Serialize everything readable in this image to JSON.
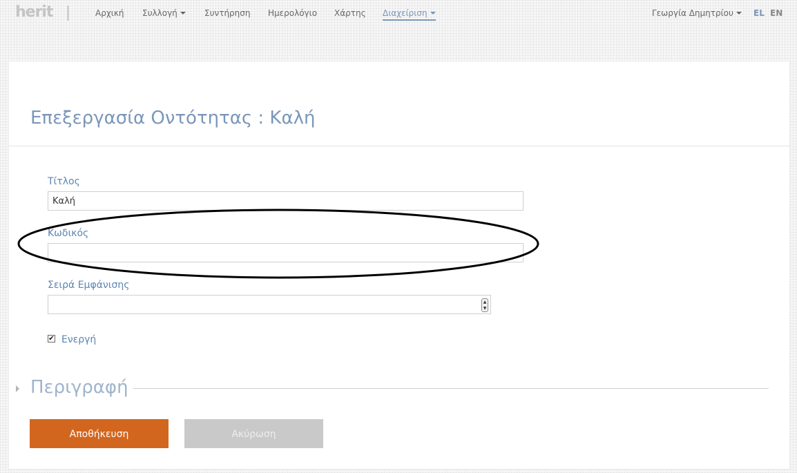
{
  "logo": {
    "text": "herit"
  },
  "nav": {
    "items": [
      {
        "label": "Αρχική"
      },
      {
        "label": "Συλλογή"
      },
      {
        "label": "Συντήρηση"
      },
      {
        "label": "Ημερολόγιο"
      },
      {
        "label": "Χάρτης"
      },
      {
        "label": "Διαχείριση"
      }
    ],
    "user": "Γεωργία Δημητρίου",
    "languages": [
      {
        "code": "EL",
        "active": true
      },
      {
        "code": "EN",
        "active": false
      }
    ]
  },
  "page": {
    "title": "Επεξεργασία Οντότητας : Καλή"
  },
  "form": {
    "title_label": "Τίτλος",
    "title_value": "Καλή",
    "code_label": "Κωδικός",
    "code_value": "",
    "order_label": "Σειρά Εμφάνισης",
    "order_value": "",
    "active_label": "Ενεργή",
    "active_checked": true
  },
  "section": {
    "description_label": "Περιγραφή"
  },
  "buttons": {
    "save": "Αποθήκευση",
    "cancel": "Ακύρωση"
  },
  "colors": {
    "accent": "#7a96b8",
    "label": "#5b85b3",
    "save_button": "#d2661f",
    "cancel_button": "#c9c9c9"
  }
}
